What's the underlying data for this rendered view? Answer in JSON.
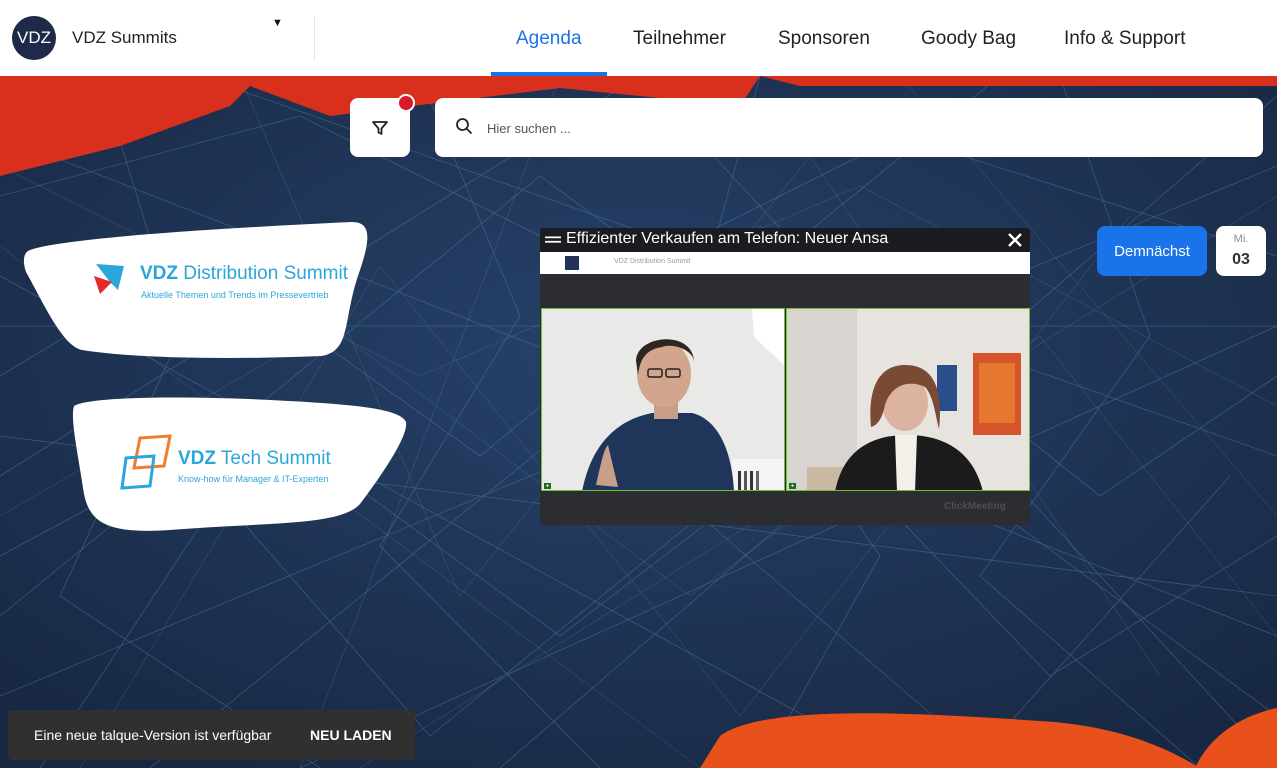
{
  "header": {
    "avatar_text": "VDZ",
    "brand_name": "VDZ Summits",
    "nav": [
      "Agenda",
      "Teilnehmer",
      "Sponsoren",
      "Goody Bag",
      "Info & Support"
    ],
    "active_tab": "Agenda"
  },
  "search": {
    "placeholder": "Hier suchen ...",
    "filter_active": true
  },
  "logos": {
    "distribution": {
      "title_bold": "VDZ",
      "title_rest": " Distribution Summit",
      "subtitle": "Aktuelle Themen und Trends im Pressevertrieb"
    },
    "tech": {
      "title_bold": "VDZ",
      "title_rest": " Tech Summit",
      "subtitle": "Know-how für Manager & IT-Experten"
    }
  },
  "video": {
    "title": "Effizienter Verkaufen am Telefon: Neuer Ansa",
    "screen_text": "VDZ Distribution Summit",
    "watermark": "ClickMeeting"
  },
  "upcoming": {
    "button_label": "Demnächst",
    "weekday": "Mi.",
    "day": "03"
  },
  "snackbar": {
    "message": "Eine neue talque-Version ist verfügbar",
    "action": "NEU LADEN"
  },
  "colors": {
    "accent": "#1a73e8",
    "background": "#1d2f4d",
    "brand_red": "#d9301d",
    "notification_dot": "#d7192a"
  }
}
